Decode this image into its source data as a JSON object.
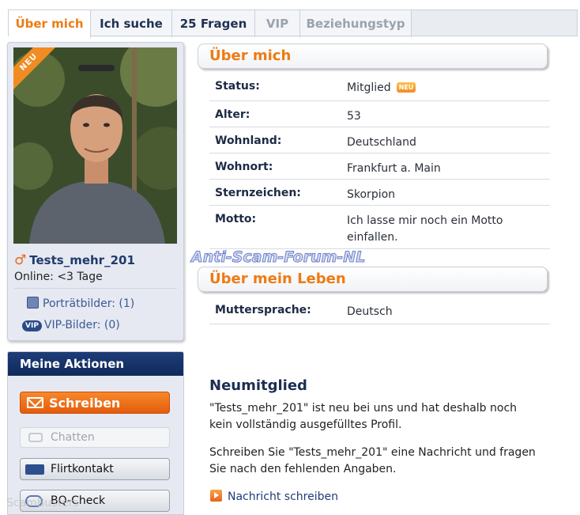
{
  "tabs": [
    {
      "label": "Über mich",
      "state": "active"
    },
    {
      "label": "Ich suche",
      "state": "normal"
    },
    {
      "label": "25 Fragen",
      "state": "normal"
    },
    {
      "label": "VIP",
      "state": "disabled"
    },
    {
      "label": "Beziehungstyp",
      "state": "disabled"
    }
  ],
  "profile": {
    "ribbon": "NEU",
    "gender_icon": "male-symbol-icon",
    "gender_symbol": "♂",
    "username": "Tests_mehr_201",
    "online": "Online: <3 Tage",
    "portrait_pics": "Porträtbilder: (1)",
    "vip_badge": "VIP",
    "vip_pics": "VIP-Bilder: (0)"
  },
  "actions": {
    "title": "Meine Aktionen",
    "write": "Schreiben",
    "chat": "Chatten",
    "flirt": "Flirtkontakt",
    "bq": "BQ-Check"
  },
  "about": {
    "title": "Über mich",
    "status_key": "Status:",
    "status_val": "Mitglied",
    "status_badge": "NEU",
    "age_key": "Alter:",
    "age_val": "53",
    "country_key": "Wohnland:",
    "country_val": "Deutschland",
    "city_key": "Wohnort:",
    "city_val": "Frankfurt a. Main",
    "zodiac_key": "Sternzeichen:",
    "zodiac_val": "Skorpion",
    "motto_key": "Motto:",
    "motto_val": "Ich lasse mir noch ein Motto einfallen."
  },
  "life": {
    "title": "Über mein Leben",
    "lang_key": "Muttersprache:",
    "lang_val": "Deutsch"
  },
  "watermark": "Anti-Scam-Forum-NL",
  "watermark2": "ScamBusters",
  "new_member": {
    "title": "Neumitglied",
    "text1": "\"Tests_mehr_201\" ist neu bei uns und hat deshalb noch kein vollständig ausgefülltes Profil.",
    "text2": "Schreiben Sie \"Tests_mehr_201\" eine Nachricht und fragen Sie nach den fehlenden Angaben.",
    "link": "Nachricht schreiben"
  },
  "colors": {
    "accent_orange": "#ee7b13",
    "navy": "#1c2e52",
    "link_blue": "#3a5a95"
  }
}
